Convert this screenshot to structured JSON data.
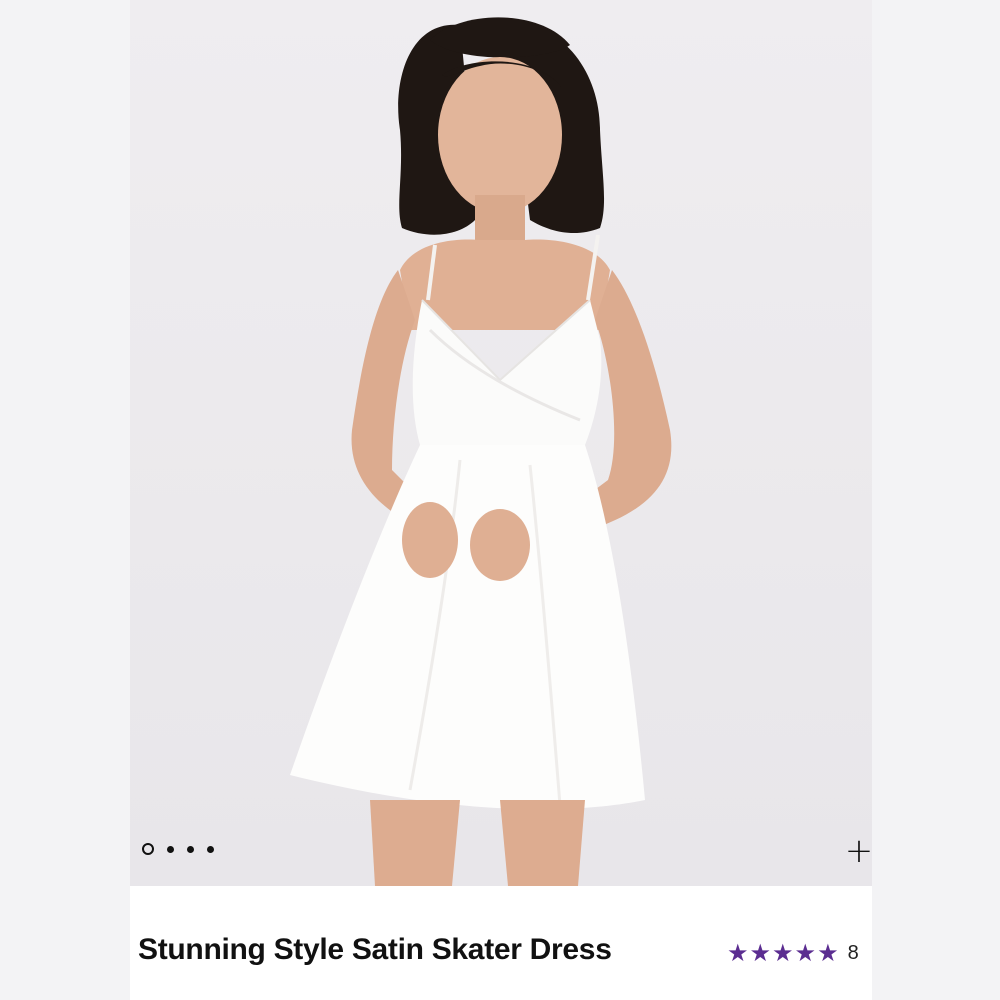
{
  "product": {
    "title": "Stunning Style Satin Skater Dress",
    "rating_stars": 5,
    "review_count_visible": "8"
  },
  "gallery": {
    "image_count": 4,
    "active_index": 0,
    "zoom_icon": "plus-icon",
    "zoom_label": "+"
  },
  "colors": {
    "star": "#5b2d91",
    "page_background": "#f4f4f6",
    "card_background": "#ffffff"
  },
  "icons": {
    "star": "star-icon",
    "zoom": "plus-icon"
  }
}
